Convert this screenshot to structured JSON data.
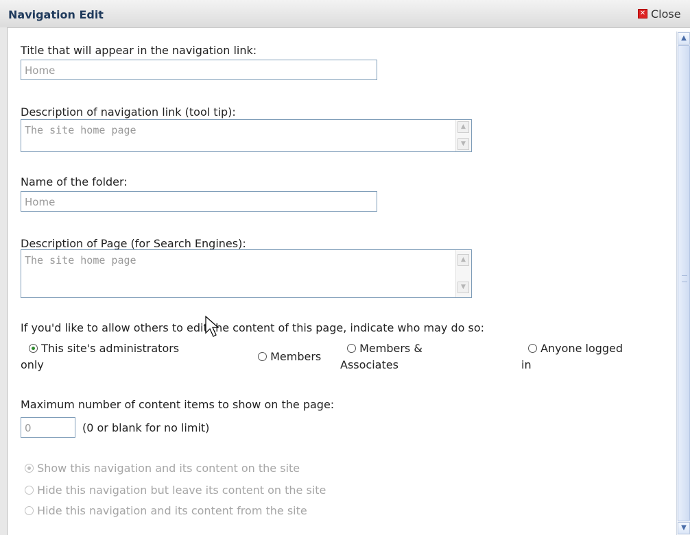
{
  "dialog": {
    "title": "Navigation Edit",
    "close_label": "Close"
  },
  "fields": {
    "title": {
      "label": "Title that will appear in the navigation link:",
      "value": "Home"
    },
    "tooltip": {
      "label": "Description of navigation link (tool tip):",
      "value": "The site home page"
    },
    "folder": {
      "label": "Name of the folder:",
      "value": "Home"
    },
    "page_description": {
      "label": "Description of Page (for Search Engines):",
      "value": "The site home page"
    }
  },
  "permissions": {
    "label": "If you'd like to allow others to edit the content of this page, indicate who may do so:",
    "options": [
      {
        "line1": "This site's administrators",
        "line2": "only",
        "selected": true
      },
      {
        "line1": "Members",
        "line2": "",
        "selected": false
      },
      {
        "line1": "Members &",
        "line2": "Associates",
        "selected": false
      },
      {
        "line1": "Anyone logged",
        "line2": "in",
        "selected": false
      }
    ]
  },
  "max_items": {
    "label": "Maximum number of content items to show on the page:",
    "value": "0",
    "hint": "(0 or blank for no limit)"
  },
  "visibility": {
    "options": [
      {
        "label": "Show this navigation and its content on the site",
        "selected": true
      },
      {
        "label": "Hide this navigation but leave its content on the site",
        "selected": false
      },
      {
        "label": "Hide this navigation and its content from the site",
        "selected": false
      }
    ]
  },
  "icons": {
    "close": "close-icon",
    "scroll_up": "chevron-up-icon",
    "scroll_down": "chevron-down-icon",
    "pointer": "mouse-pointer-icon"
  },
  "colors": {
    "title_text": "#1f3a5c",
    "close_icon": "#dd2222",
    "field_border": "#7f9db9",
    "selected_radio": "#2e8b2e",
    "disabled_text": "#a6a6a6"
  }
}
